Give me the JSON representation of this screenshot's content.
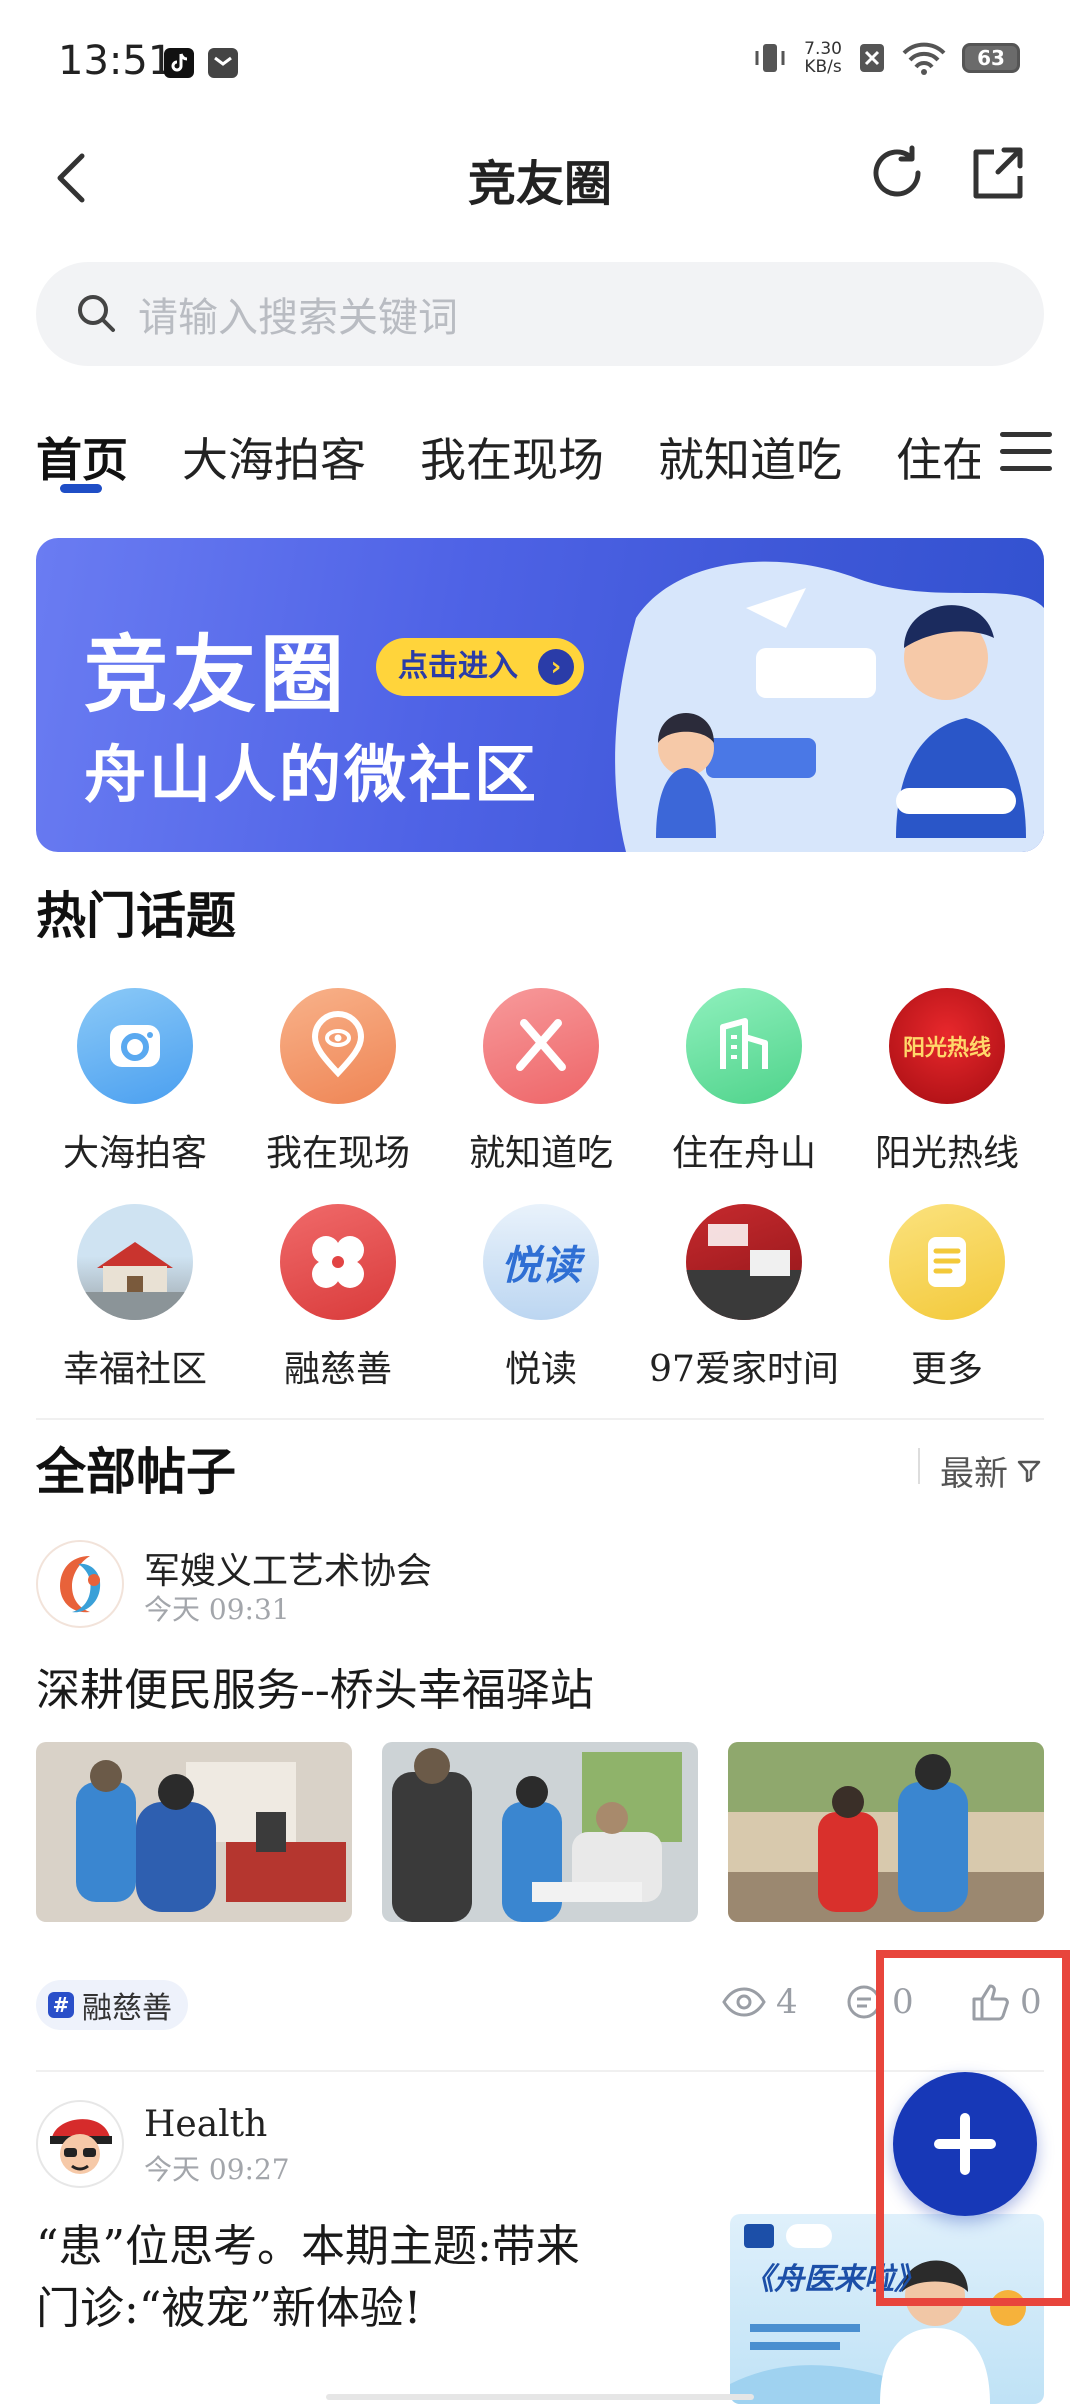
{
  "status_bar": {
    "time": "13:51",
    "net_speed_value": "7.30",
    "net_speed_unit": "KB/s",
    "battery": "63"
  },
  "header": {
    "title": "竞友圈"
  },
  "search": {
    "placeholder": "请输入搜索关键词"
  },
  "tabs": [
    {
      "label": "首页",
      "active": true
    },
    {
      "label": "大海拍客"
    },
    {
      "label": "我在现场"
    },
    {
      "label": "就知道吃"
    },
    {
      "label": "住在舟山"
    }
  ],
  "banner": {
    "title": "竞友圈",
    "button_label": "点击进入",
    "subtitle": "舟山人的微社区"
  },
  "hot_topics": {
    "heading": "热门话题",
    "items": [
      {
        "label": "大海拍客",
        "icon": "camera-icon",
        "color": "#5aa9f0"
      },
      {
        "label": "我在现场",
        "icon": "location-eye-icon",
        "color": "#f39a6b"
      },
      {
        "label": "就知道吃",
        "icon": "fork-knife-icon",
        "color": "#f2787b"
      },
      {
        "label": "住在舟山",
        "icon": "building-icon",
        "color": "#5fd89a"
      },
      {
        "label": "阳光热线",
        "icon": "sunshine-hotline-logo",
        "color": "#c8141b",
        "logo_text": "阳光热线"
      },
      {
        "label": "幸福社区",
        "icon": "community-photo-icon",
        "color": "#c9342e"
      },
      {
        "label": "融慈善",
        "icon": "charity-flower-icon",
        "color": "#e24444"
      },
      {
        "label": "悦读",
        "icon": "reading-logo",
        "color": "#3a78d8",
        "logo_text": "悦读"
      },
      {
        "label": "97爱家时间",
        "icon": "love-home-logo",
        "color": "#b21e22"
      },
      {
        "label": "更多",
        "icon": "document-icon",
        "color": "#f6cf4a"
      }
    ]
  },
  "posts_section": {
    "heading": "全部帖子",
    "sort_label": "最新"
  },
  "posts": [
    {
      "author": "军嫂义工艺术协会",
      "time": "今天  09:31",
      "title": "深耕便民服务--桥头幸福驿站",
      "tag": "融慈善",
      "views": "4",
      "comments": "0",
      "likes": "0"
    },
    {
      "author": "Health",
      "time": "今天  09:27",
      "title_line1": "“患”位思考。本期主题:带来",
      "title_line2": "门诊:“被宠”新体验!",
      "thumb_text": "《舟医来啦》"
    }
  ]
}
